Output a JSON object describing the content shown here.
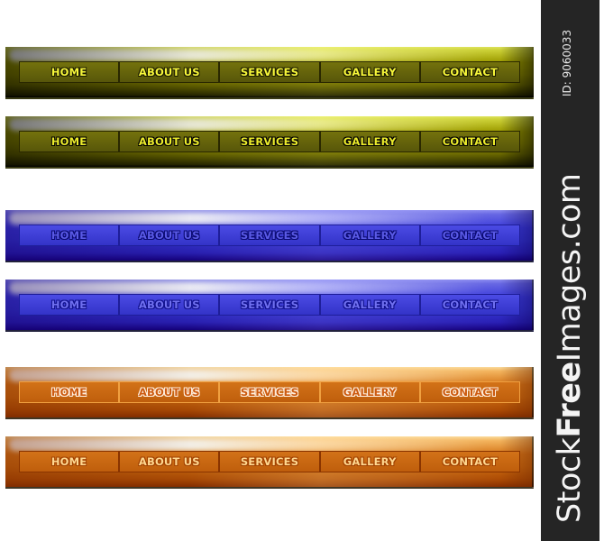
{
  "nav_items": [
    "HOME",
    "ABOUT US",
    "SERVICES",
    "GALLERY",
    "CONTACT"
  ],
  "navbars": [
    {
      "theme": "olive",
      "variant": "normal",
      "base_color": "#8f8c00",
      "text_color": "#f6f63a"
    },
    {
      "theme": "olive",
      "variant": "alt",
      "base_color": "#8f8c00",
      "text_color": "#ecec2c"
    },
    {
      "theme": "blue",
      "variant": "normal",
      "base_color": "#3d3dde",
      "text_color": "#5a5ae6"
    },
    {
      "theme": "blue",
      "variant": "alt",
      "base_color": "#3d3dde",
      "text_color": "#7070f0"
    },
    {
      "theme": "orange",
      "variant": "normal",
      "base_color": "#d9781a",
      "text_color": "#cc5a10"
    },
    {
      "theme": "orange",
      "variant": "alt",
      "base_color": "#d9781a",
      "text_color": "#ffd890"
    }
  ],
  "watermark": {
    "brand_prefix": "Stock",
    "brand_bold": "Free",
    "brand_suffix": "Images.com",
    "id_label": "ID: 9060033"
  }
}
